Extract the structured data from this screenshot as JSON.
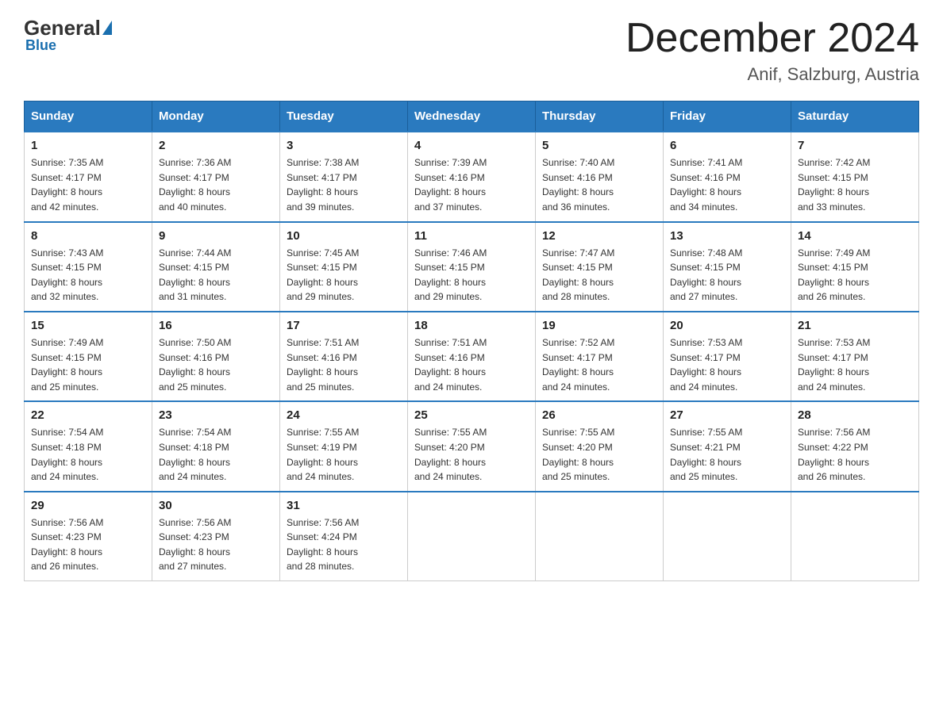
{
  "header": {
    "logo_general": "General",
    "logo_blue": "Blue",
    "title": "December 2024",
    "subtitle": "Anif, Salzburg, Austria"
  },
  "weekdays": [
    "Sunday",
    "Monday",
    "Tuesday",
    "Wednesday",
    "Thursday",
    "Friday",
    "Saturday"
  ],
  "weeks": [
    [
      {
        "day": "1",
        "sunrise": "Sunrise: 7:35 AM",
        "sunset": "Sunset: 4:17 PM",
        "daylight": "Daylight: 8 hours",
        "daylight2": "and 42 minutes."
      },
      {
        "day": "2",
        "sunrise": "Sunrise: 7:36 AM",
        "sunset": "Sunset: 4:17 PM",
        "daylight": "Daylight: 8 hours",
        "daylight2": "and 40 minutes."
      },
      {
        "day": "3",
        "sunrise": "Sunrise: 7:38 AM",
        "sunset": "Sunset: 4:17 PM",
        "daylight": "Daylight: 8 hours",
        "daylight2": "and 39 minutes."
      },
      {
        "day": "4",
        "sunrise": "Sunrise: 7:39 AM",
        "sunset": "Sunset: 4:16 PM",
        "daylight": "Daylight: 8 hours",
        "daylight2": "and 37 minutes."
      },
      {
        "day": "5",
        "sunrise": "Sunrise: 7:40 AM",
        "sunset": "Sunset: 4:16 PM",
        "daylight": "Daylight: 8 hours",
        "daylight2": "and 36 minutes."
      },
      {
        "day": "6",
        "sunrise": "Sunrise: 7:41 AM",
        "sunset": "Sunset: 4:16 PM",
        "daylight": "Daylight: 8 hours",
        "daylight2": "and 34 minutes."
      },
      {
        "day": "7",
        "sunrise": "Sunrise: 7:42 AM",
        "sunset": "Sunset: 4:15 PM",
        "daylight": "Daylight: 8 hours",
        "daylight2": "and 33 minutes."
      }
    ],
    [
      {
        "day": "8",
        "sunrise": "Sunrise: 7:43 AM",
        "sunset": "Sunset: 4:15 PM",
        "daylight": "Daylight: 8 hours",
        "daylight2": "and 32 minutes."
      },
      {
        "day": "9",
        "sunrise": "Sunrise: 7:44 AM",
        "sunset": "Sunset: 4:15 PM",
        "daylight": "Daylight: 8 hours",
        "daylight2": "and 31 minutes."
      },
      {
        "day": "10",
        "sunrise": "Sunrise: 7:45 AM",
        "sunset": "Sunset: 4:15 PM",
        "daylight": "Daylight: 8 hours",
        "daylight2": "and 29 minutes."
      },
      {
        "day": "11",
        "sunrise": "Sunrise: 7:46 AM",
        "sunset": "Sunset: 4:15 PM",
        "daylight": "Daylight: 8 hours",
        "daylight2": "and 29 minutes."
      },
      {
        "day": "12",
        "sunrise": "Sunrise: 7:47 AM",
        "sunset": "Sunset: 4:15 PM",
        "daylight": "Daylight: 8 hours",
        "daylight2": "and 28 minutes."
      },
      {
        "day": "13",
        "sunrise": "Sunrise: 7:48 AM",
        "sunset": "Sunset: 4:15 PM",
        "daylight": "Daylight: 8 hours",
        "daylight2": "and 27 minutes."
      },
      {
        "day": "14",
        "sunrise": "Sunrise: 7:49 AM",
        "sunset": "Sunset: 4:15 PM",
        "daylight": "Daylight: 8 hours",
        "daylight2": "and 26 minutes."
      }
    ],
    [
      {
        "day": "15",
        "sunrise": "Sunrise: 7:49 AM",
        "sunset": "Sunset: 4:15 PM",
        "daylight": "Daylight: 8 hours",
        "daylight2": "and 25 minutes."
      },
      {
        "day": "16",
        "sunrise": "Sunrise: 7:50 AM",
        "sunset": "Sunset: 4:16 PM",
        "daylight": "Daylight: 8 hours",
        "daylight2": "and 25 minutes."
      },
      {
        "day": "17",
        "sunrise": "Sunrise: 7:51 AM",
        "sunset": "Sunset: 4:16 PM",
        "daylight": "Daylight: 8 hours",
        "daylight2": "and 25 minutes."
      },
      {
        "day": "18",
        "sunrise": "Sunrise: 7:51 AM",
        "sunset": "Sunset: 4:16 PM",
        "daylight": "Daylight: 8 hours",
        "daylight2": "and 24 minutes."
      },
      {
        "day": "19",
        "sunrise": "Sunrise: 7:52 AM",
        "sunset": "Sunset: 4:17 PM",
        "daylight": "Daylight: 8 hours",
        "daylight2": "and 24 minutes."
      },
      {
        "day": "20",
        "sunrise": "Sunrise: 7:53 AM",
        "sunset": "Sunset: 4:17 PM",
        "daylight": "Daylight: 8 hours",
        "daylight2": "and 24 minutes."
      },
      {
        "day": "21",
        "sunrise": "Sunrise: 7:53 AM",
        "sunset": "Sunset: 4:17 PM",
        "daylight": "Daylight: 8 hours",
        "daylight2": "and 24 minutes."
      }
    ],
    [
      {
        "day": "22",
        "sunrise": "Sunrise: 7:54 AM",
        "sunset": "Sunset: 4:18 PM",
        "daylight": "Daylight: 8 hours",
        "daylight2": "and 24 minutes."
      },
      {
        "day": "23",
        "sunrise": "Sunrise: 7:54 AM",
        "sunset": "Sunset: 4:18 PM",
        "daylight": "Daylight: 8 hours",
        "daylight2": "and 24 minutes."
      },
      {
        "day": "24",
        "sunrise": "Sunrise: 7:55 AM",
        "sunset": "Sunset: 4:19 PM",
        "daylight": "Daylight: 8 hours",
        "daylight2": "and 24 minutes."
      },
      {
        "day": "25",
        "sunrise": "Sunrise: 7:55 AM",
        "sunset": "Sunset: 4:20 PM",
        "daylight": "Daylight: 8 hours",
        "daylight2": "and 24 minutes."
      },
      {
        "day": "26",
        "sunrise": "Sunrise: 7:55 AM",
        "sunset": "Sunset: 4:20 PM",
        "daylight": "Daylight: 8 hours",
        "daylight2": "and 25 minutes."
      },
      {
        "day": "27",
        "sunrise": "Sunrise: 7:55 AM",
        "sunset": "Sunset: 4:21 PM",
        "daylight": "Daylight: 8 hours",
        "daylight2": "and 25 minutes."
      },
      {
        "day": "28",
        "sunrise": "Sunrise: 7:56 AM",
        "sunset": "Sunset: 4:22 PM",
        "daylight": "Daylight: 8 hours",
        "daylight2": "and 26 minutes."
      }
    ],
    [
      {
        "day": "29",
        "sunrise": "Sunrise: 7:56 AM",
        "sunset": "Sunset: 4:23 PM",
        "daylight": "Daylight: 8 hours",
        "daylight2": "and 26 minutes."
      },
      {
        "day": "30",
        "sunrise": "Sunrise: 7:56 AM",
        "sunset": "Sunset: 4:23 PM",
        "daylight": "Daylight: 8 hours",
        "daylight2": "and 27 minutes."
      },
      {
        "day": "31",
        "sunrise": "Sunrise: 7:56 AM",
        "sunset": "Sunset: 4:24 PM",
        "daylight": "Daylight: 8 hours",
        "daylight2": "and 28 minutes."
      },
      null,
      null,
      null,
      null
    ]
  ]
}
